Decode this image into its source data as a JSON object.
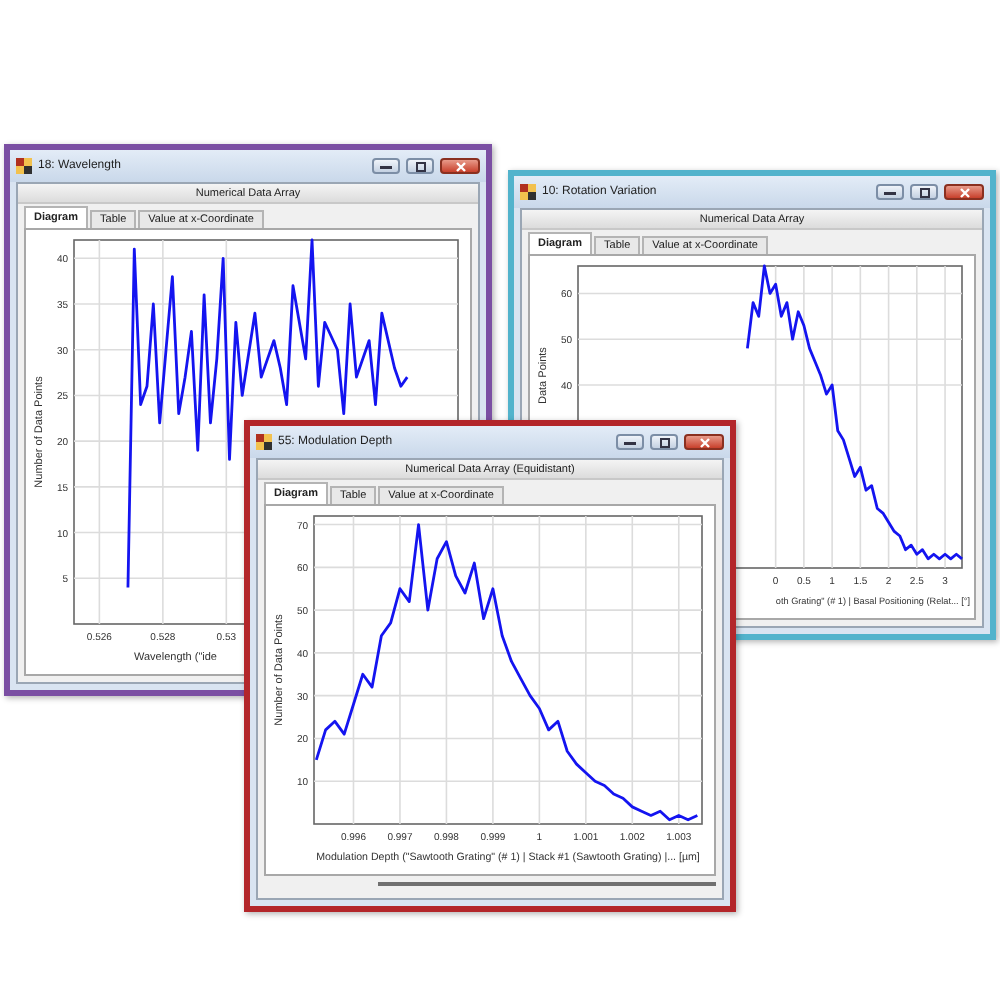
{
  "windows": [
    {
      "title": "18: Wavelength",
      "color": "#7b4fa3",
      "header": "Numerical Data Array",
      "tabs": [
        {
          "label": "Diagram",
          "selected": true
        },
        {
          "label": "Table",
          "selected": false
        },
        {
          "label": "Value at x-Coordinate",
          "selected": false
        }
      ],
      "chart_data": {
        "type": "line",
        "xlabel": "Wavelength (\"ide",
        "ylabel": "Number of Data Points",
        "xlim": [
          0.5252,
          0.5373
        ],
        "ylim": [
          0,
          42
        ],
        "xticks": [
          0.526,
          0.528,
          0.53
        ],
        "yticks": [
          5,
          10,
          15,
          20,
          25,
          30,
          35,
          40
        ],
        "x": [
          0.5269,
          0.5271,
          0.5273,
          0.5275,
          0.5277,
          0.5279,
          0.5281,
          0.5283,
          0.5285,
          0.5287,
          0.5289,
          0.5291,
          0.5293,
          0.5295,
          0.5297,
          0.5299,
          0.5301,
          0.5303,
          0.5305,
          0.5309,
          0.5311,
          0.5315,
          0.5317,
          0.5319,
          0.5321,
          0.5325,
          0.5327,
          0.5329,
          0.5331,
          0.5335,
          0.5337,
          0.5339,
          0.5341,
          0.5345,
          0.5347,
          0.5349,
          0.5353,
          0.5355,
          0.5357
        ],
        "grid": true,
        "series": [
          {
            "color": "#1414f0",
            "values": [
              4,
              41,
              24,
              26,
              35,
              22,
              30,
              38,
              23,
              27,
              32,
              19,
              36,
              22,
              29,
              40,
              18,
              33,
              25,
              34,
              27,
              31,
              28,
              24,
              37,
              29,
              42,
              26,
              33,
              30,
              23,
              35,
              27,
              31,
              24,
              34,
              28,
              26,
              27
            ]
          }
        ]
      }
    },
    {
      "title": "10: Rotation Variation",
      "color": "#52b3cc",
      "header": "Numerical Data Array",
      "tabs": [
        {
          "label": "Diagram",
          "selected": true
        },
        {
          "label": "Table",
          "selected": false
        },
        {
          "label": "Value at x-Coordinate",
          "selected": false
        }
      ],
      "chart_data": {
        "type": "line",
        "xlabel": "oth Grating\" (# 1) | Basal Positioning (Relat... [°]",
        "ylabel": "Data Points",
        "xlim": [
          -3.5,
          3.3
        ],
        "ylim": [
          0,
          66
        ],
        "xticks": [
          0,
          0.5,
          1,
          1.5,
          2,
          2.5,
          3
        ],
        "yticks": [
          40,
          50,
          60
        ],
        "grid": true,
        "x": [
          -0.5,
          -0.4,
          -0.3,
          -0.2,
          -0.1,
          0,
          0.1,
          0.2,
          0.3,
          0.4,
          0.5,
          0.6,
          0.7,
          0.8,
          0.9,
          1,
          1.1,
          1.2,
          1.3,
          1.4,
          1.5,
          1.6,
          1.7,
          1.8,
          1.9,
          2,
          2.1,
          2.2,
          2.3,
          2.4,
          2.5,
          2.6,
          2.7,
          2.8,
          2.9,
          3,
          3.1,
          3.2,
          3.3
        ],
        "series": [
          {
            "color": "#1414f0",
            "values": [
              48,
              58,
              55,
              66,
              60,
              62,
              55,
              58,
              50,
              56,
              53,
              48,
              45,
              42,
              38,
              40,
              30,
              28,
              24,
              20,
              22,
              17,
              18,
              13,
              12,
              10,
              8,
              7,
              4,
              5,
              3,
              4,
              2,
              3,
              2,
              3,
              2,
              3,
              2
            ]
          }
        ]
      }
    },
    {
      "title": "55: Modulation Depth",
      "color": "#b3262a",
      "header": "Numerical Data Array (Equidistant)",
      "tabs": [
        {
          "label": "Diagram",
          "selected": true
        },
        {
          "label": "Table",
          "selected": false
        },
        {
          "label": "Value at x-Coordinate",
          "selected": false
        }
      ],
      "chart_data": {
        "type": "line",
        "xlabel": "Modulation Depth (\"Sawtooth Grating\" (# 1) | Stack #1 (Sawtooth Grating) |... [µm]",
        "ylabel": "Number of Data Points",
        "xlim": [
          0.99515,
          1.0035
        ],
        "ylim": [
          0,
          72
        ],
        "xticks": [
          0.996,
          0.997,
          0.998,
          0.999,
          1,
          1.001,
          1.002,
          1.003
        ],
        "yticks": [
          10,
          20,
          30,
          40,
          50,
          60,
          70
        ],
        "grid": true,
        "x": [
          0.9952,
          0.9954,
          0.9956,
          0.9958,
          0.996,
          0.9962,
          0.9964,
          0.9966,
          0.9968,
          0.997,
          0.9972,
          0.9974,
          0.9976,
          0.9978,
          0.998,
          0.9982,
          0.9984,
          0.9986,
          0.9988,
          0.999,
          0.9992,
          0.9994,
          0.9996,
          0.9998,
          1,
          1.0002,
          1.0004,
          1.0006,
          1.0008,
          1.001,
          1.0012,
          1.0014,
          1.0016,
          1.0018,
          1.002,
          1.0022,
          1.0024,
          1.0026,
          1.0028,
          1.003,
          1.0032,
          1.0034
        ],
        "series": [
          {
            "color": "#1414f0",
            "values": [
              15,
              22,
              24,
              21,
              28,
              35,
              32,
              44,
              47,
              55,
              52,
              70,
              50,
              62,
              66,
              58,
              54,
              61,
              48,
              55,
              44,
              38,
              34,
              30,
              27,
              22,
              24,
              17,
              14,
              12,
              10,
              9,
              7,
              6,
              4,
              3,
              2,
              3,
              1,
              2,
              1,
              2
            ]
          }
        ]
      }
    }
  ]
}
